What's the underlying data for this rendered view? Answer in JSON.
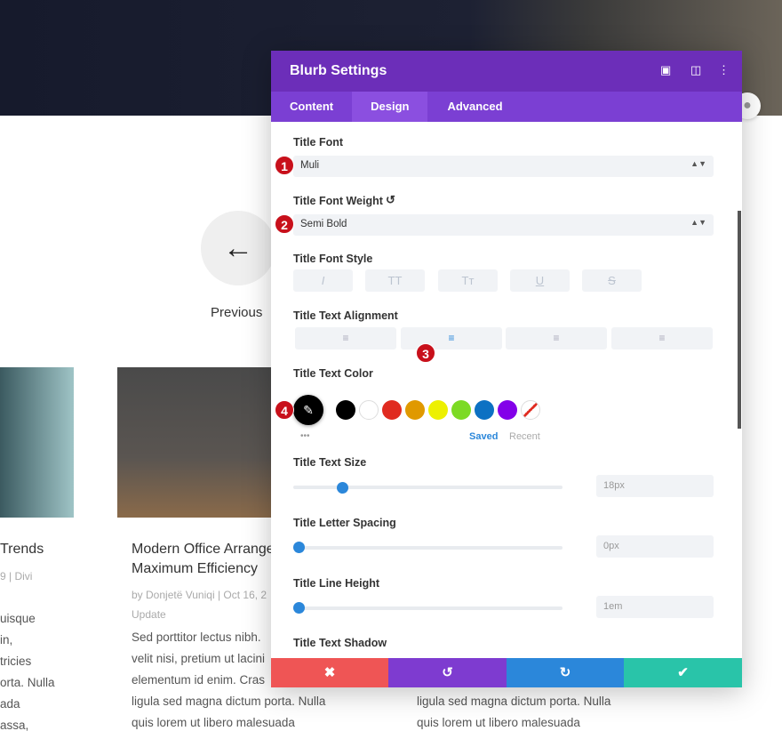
{
  "page": {
    "previous_label": "Previous",
    "previous_icon": "arrow-left-icon",
    "posts": [
      {
        "title": "Trends",
        "meta": "9 | Divi",
        "body": [
          "uisque",
          "in,",
          "tricies",
          "orta. Nulla",
          "ada",
          "assa,"
        ]
      },
      {
        "title_lines": [
          "Modern Office Arrange",
          "Maximum Efficiency"
        ],
        "meta_lines": [
          "by Donjetë Vuniqi | Oct 16, 2",
          "Update"
        ],
        "body": [
          "Sed porttitor lectus nibh.",
          "velit nisi, pretium ut lacini",
          "elementum id enim. Cras",
          "ligula sed magna dictum porta. Nulla",
          "quis lorem ut libero malesuada"
        ]
      },
      {
        "body": [
          "ligula sed magna dictum porta. Nulla",
          "quis lorem ut libero malesuada"
        ]
      }
    ]
  },
  "modal": {
    "title": "Blurb Settings",
    "tabs": [
      {
        "label": "Content"
      },
      {
        "label": "Design"
      },
      {
        "label": "Advanced"
      }
    ],
    "active_tab": "Design",
    "title_font": {
      "label": "Title Font",
      "value": "Muli",
      "badge": "1"
    },
    "title_font_weight": {
      "label": "Title Font Weight",
      "value": "Semi Bold",
      "badge": "2"
    },
    "title_font_style": {
      "label": "Title Font Style",
      "buttons": [
        "I",
        "TT",
        "Tт",
        "U",
        "S"
      ]
    },
    "title_text_alignment": {
      "label": "Title Text Alignment",
      "options": [
        "left",
        "center",
        "right",
        "justify"
      ],
      "selected": "center",
      "badge": "3"
    },
    "title_text_color": {
      "label": "Title Text Color",
      "badge": "4",
      "current": "#000000",
      "swatches": [
        "#000000",
        "#ffffff",
        "#e02b20",
        "#e09900",
        "#edf000",
        "#7cda24",
        "#0c71c3",
        "#8300e9"
      ],
      "more": "•••",
      "saved": "Saved",
      "recent": "Recent"
    },
    "title_text_size": {
      "label": "Title Text Size",
      "value": "18px",
      "fraction": 0.18
    },
    "title_letter_spacing": {
      "label": "Title Letter Spacing",
      "value": "0px",
      "fraction": 0
    },
    "title_line_height": {
      "label": "Title Line Height",
      "value": "1em",
      "fraction": 0
    },
    "title_text_shadow": {
      "label": "Title Text Shadow"
    },
    "footer": {
      "cancel": "✖",
      "undo": "↺",
      "redo": "↻",
      "save": "✔"
    },
    "colors": {
      "header": "#6c2eb9",
      "tabs": "#7b3fd3",
      "cancel": "#ef5555",
      "undo": "#7e3bd0",
      "redo": "#2b87da",
      "save": "#29c4a9"
    }
  }
}
